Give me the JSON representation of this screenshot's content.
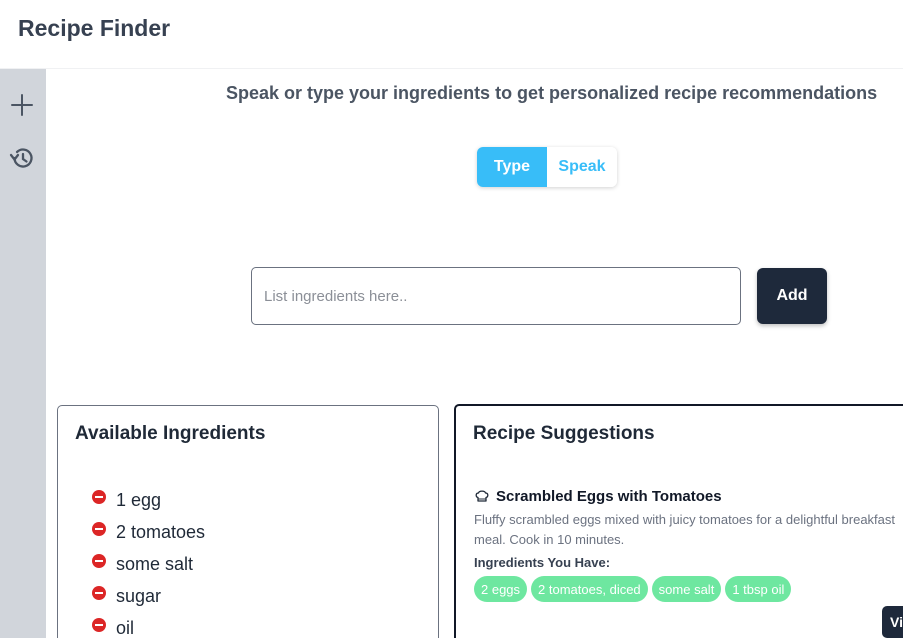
{
  "app": {
    "title": "Recipe Finder"
  },
  "sidebar": {
    "items": [
      {
        "icon": "plus-icon"
      },
      {
        "icon": "history-icon"
      }
    ]
  },
  "main": {
    "subtitle": "Speak or type your ingredients to get personalized recipe recommendations",
    "mode_toggle": {
      "options": [
        "Type",
        "Speak"
      ],
      "selected": "Type"
    },
    "input": {
      "placeholder": "List ingredients here..",
      "value": ""
    },
    "add_label": "Add"
  },
  "ingredients_card": {
    "title": "Available Ingredients",
    "items": [
      "1 egg",
      "2 tomatoes",
      "some salt",
      "sugar",
      "oil"
    ]
  },
  "recipes_card": {
    "title": "Recipe Suggestions",
    "recipe": {
      "icon": "chef-hat-icon",
      "name": "Scrambled Eggs with Tomatoes",
      "description": "Fluffy scrambled eggs mixed with juicy tomatoes for a delightful breakfast meal. Cook in 10 minutes.",
      "have_label": "Ingredients You Have:",
      "have_items": [
        "2 eggs",
        "2 tomatoes, diced",
        "some salt",
        "1 tbsp oil"
      ],
      "view_label": "View"
    }
  },
  "colors": {
    "accent": "#38bdf8",
    "dark_button": "#1e293b",
    "remove": "#dc2626",
    "tag": "#6ee7a0",
    "sidebar": "#d1d5db"
  }
}
